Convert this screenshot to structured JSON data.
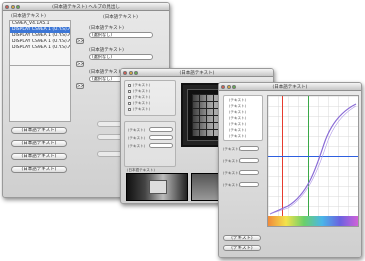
{
  "win1": {
    "title": "(日本語テキスト) ヘルプの見出し",
    "source_list_header": "(日本語テキスト)",
    "source_list": [
      "CS9EA_V4.1A5.1",
      "DISPLAY CS9EA 1 (U.Y.S).A50",
      "DISPLAY CS9EA 1 (U.Y.S).A50",
      "DISPLAY CS9EA 1 (U.Y.S).A50",
      "DISPLAY CS9EA 1 (U.Y.S).A50"
    ],
    "target_header": "(日本語テキスト)",
    "arrow_label": ">>",
    "field1_label": "(日本語テキスト)",
    "field1_value": "(選択なし)",
    "field2_label": "(日本語テキスト)",
    "field2_value": "(選択なし)",
    "field3_label": "(日本語テキスト)",
    "field3_value": "(選択なし)",
    "buttons": [
      "(日本語テキスト)",
      "(日本語テキスト)",
      "(日本語テキスト)",
      "(日本語テキスト)"
    ]
  },
  "win2": {
    "title": "(日本語テキスト)",
    "checkbox_labels": [
      "(テキスト)",
      "(テキスト)",
      "(テキスト)",
      "(テキスト)",
      "(テキスト)"
    ],
    "field_labels": [
      "(テキスト)",
      "(テキスト)",
      "(テキスト)"
    ],
    "field_values": [
      "",
      "",
      ""
    ],
    "footer_text": "(日本語テキスト)"
  },
  "win3": {
    "title": "(日本語テキスト)",
    "left_items": [
      "(テキスト)",
      "(テキスト)",
      "(テキスト)",
      "(テキスト)",
      "(テキスト)",
      "(テキスト)",
      "(テキスト)"
    ],
    "field_labels": [
      "(テキスト)",
      "(テキスト)",
      "(テキスト)",
      "(テキスト)"
    ],
    "field_values": [
      "",
      "",
      "",
      ""
    ],
    "bottom_buttons": [
      "(テキスト)",
      "(テキスト)"
    ],
    "colors": {
      "red": "#e63b2e",
      "green": "#3aa848",
      "blue": "#2e5fe0",
      "purple": "#8a6bd6"
    }
  }
}
